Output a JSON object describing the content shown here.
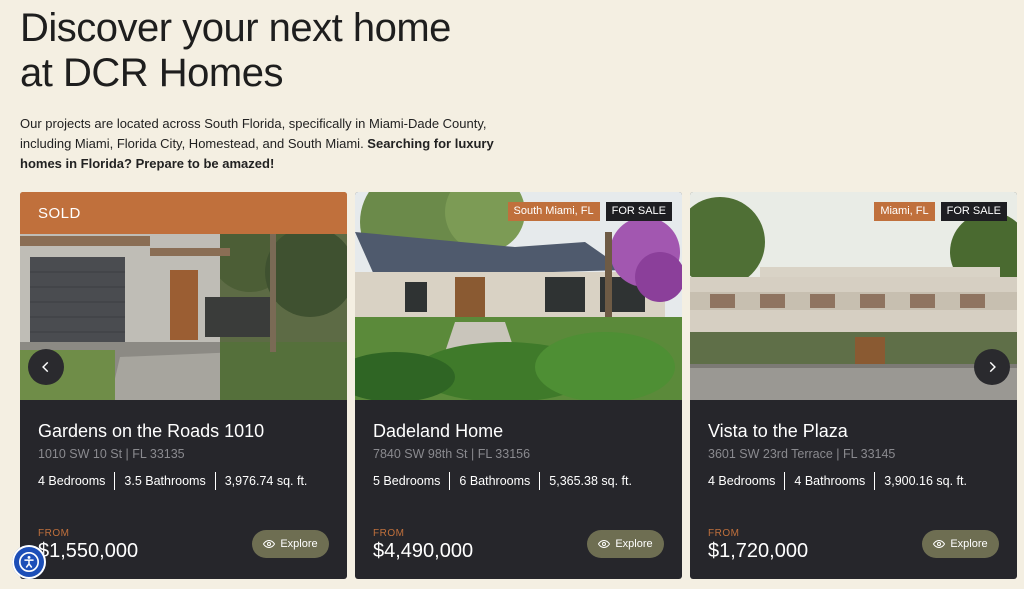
{
  "hero": {
    "title_line1": "Discover your next home",
    "title_line2": "at DCR Homes",
    "description": "Our projects are located across South Florida, specifically in Miami-Dade County, including Miami, Florida City, Homestead, and South Miami. ",
    "description_bold": "Searching for luxury homes in Florida? Prepare to be amazed!"
  },
  "cards": [
    {
      "status_banner": "SOLD",
      "name": "Gardens on the Roads 1010",
      "address": "1010 SW 10 St | FL 33135",
      "bedrooms": "4 Bedrooms",
      "bathrooms": "3.5 Bathrooms",
      "area": "3,976.74 sq. ft.",
      "from_label": "FROM",
      "price": "$1,550,000",
      "explore_label": "Explore",
      "house_number": "1010"
    },
    {
      "location_badge": "South Miami, FL",
      "sale_badge": "FOR SALE",
      "name": "Dadeland Home",
      "address": "7840 SW 98th St | FL 33156",
      "bedrooms": "5 Bedrooms",
      "bathrooms": "6 Bathrooms",
      "area": "5,365.38 sq. ft.",
      "from_label": "FROM",
      "price": "$4,490,000",
      "explore_label": "Explore"
    },
    {
      "location_badge": "Miami, FL",
      "sale_badge": "FOR SALE",
      "name": "Vista to the Plaza",
      "address": "3601 SW 23rd Terrace | FL 33145",
      "bedrooms": "4 Bedrooms",
      "bathrooms": "4 Bathrooms",
      "area": "3,900.16 sq. ft.",
      "from_label": "FROM",
      "price": "$1,720,000",
      "explore_label": "Explore"
    }
  ],
  "icons": {
    "prev": "chevron-left-icon",
    "next": "chevron-right-icon",
    "explore": "eye-icon",
    "accessibility": "accessibility-icon"
  },
  "colors": {
    "background": "#f4efe2",
    "card": "#26262b",
    "accent": "#c0703c",
    "explore_button": "#6e6e52"
  }
}
